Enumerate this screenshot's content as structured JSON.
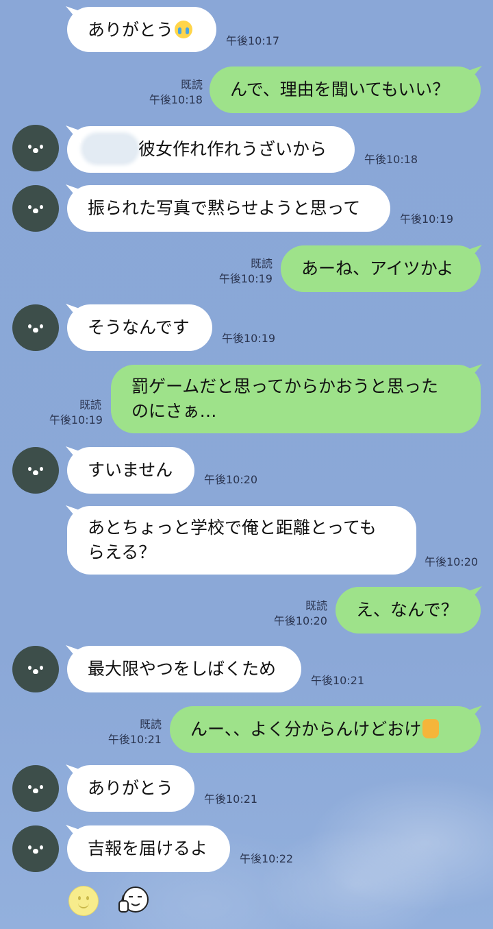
{
  "messages": [
    {
      "side": "in",
      "text": "ありがとう",
      "emoji": "crying-face",
      "time": "午後10:17"
    },
    {
      "side": "out",
      "text": "んで、理由を聞いてもいい？",
      "read": "既読",
      "time": "午後10:18"
    },
    {
      "side": "in",
      "text": "彼女作れ作れうざいから",
      "time": "午後10:18",
      "redacted": true
    },
    {
      "side": "in",
      "text": "振られた写真で黙らせようと思って",
      "time": "午後10:19"
    },
    {
      "side": "out",
      "text": "あーね、アイツかよ",
      "read": "既読",
      "time": "午後10:19"
    },
    {
      "side": "in",
      "text": "そうなんです",
      "time": "午後10:19"
    },
    {
      "side": "out",
      "line1": "罰ゲームだと思ってからかおうと思った",
      "line2": "のにさぁ…",
      "read": "既読",
      "time": "午後10:19"
    },
    {
      "side": "in",
      "text": "すいません",
      "time": "午後10:20"
    },
    {
      "side": "in",
      "line1": "あとちょっと学校で俺と距離とっても",
      "line2": "らえる？",
      "time": "午後10:20"
    },
    {
      "side": "out",
      "text": "え、なんで？",
      "read": "既読",
      "time": "午後10:20"
    },
    {
      "side": "in",
      "text": "最大限やつをしばくため",
      "time": "午後10:21"
    },
    {
      "side": "out",
      "text": "んー、、よく分からんけどおけ",
      "emoji": "thumbs-up",
      "read": "既読",
      "time": "午後10:21"
    },
    {
      "side": "in",
      "text": "ありがとう",
      "time": "午後10:21"
    },
    {
      "side": "in",
      "text": "吉報を届けるよ",
      "time": "午後10:22"
    }
  ],
  "footer": {
    "icons": [
      "smiley-face-icon",
      "sticker-icon"
    ]
  },
  "colors": {
    "background": "#8aa7d6",
    "incoming_bubble": "#ffffff",
    "outgoing_bubble": "#9ee28a",
    "avatar": "#3d4e4a"
  }
}
